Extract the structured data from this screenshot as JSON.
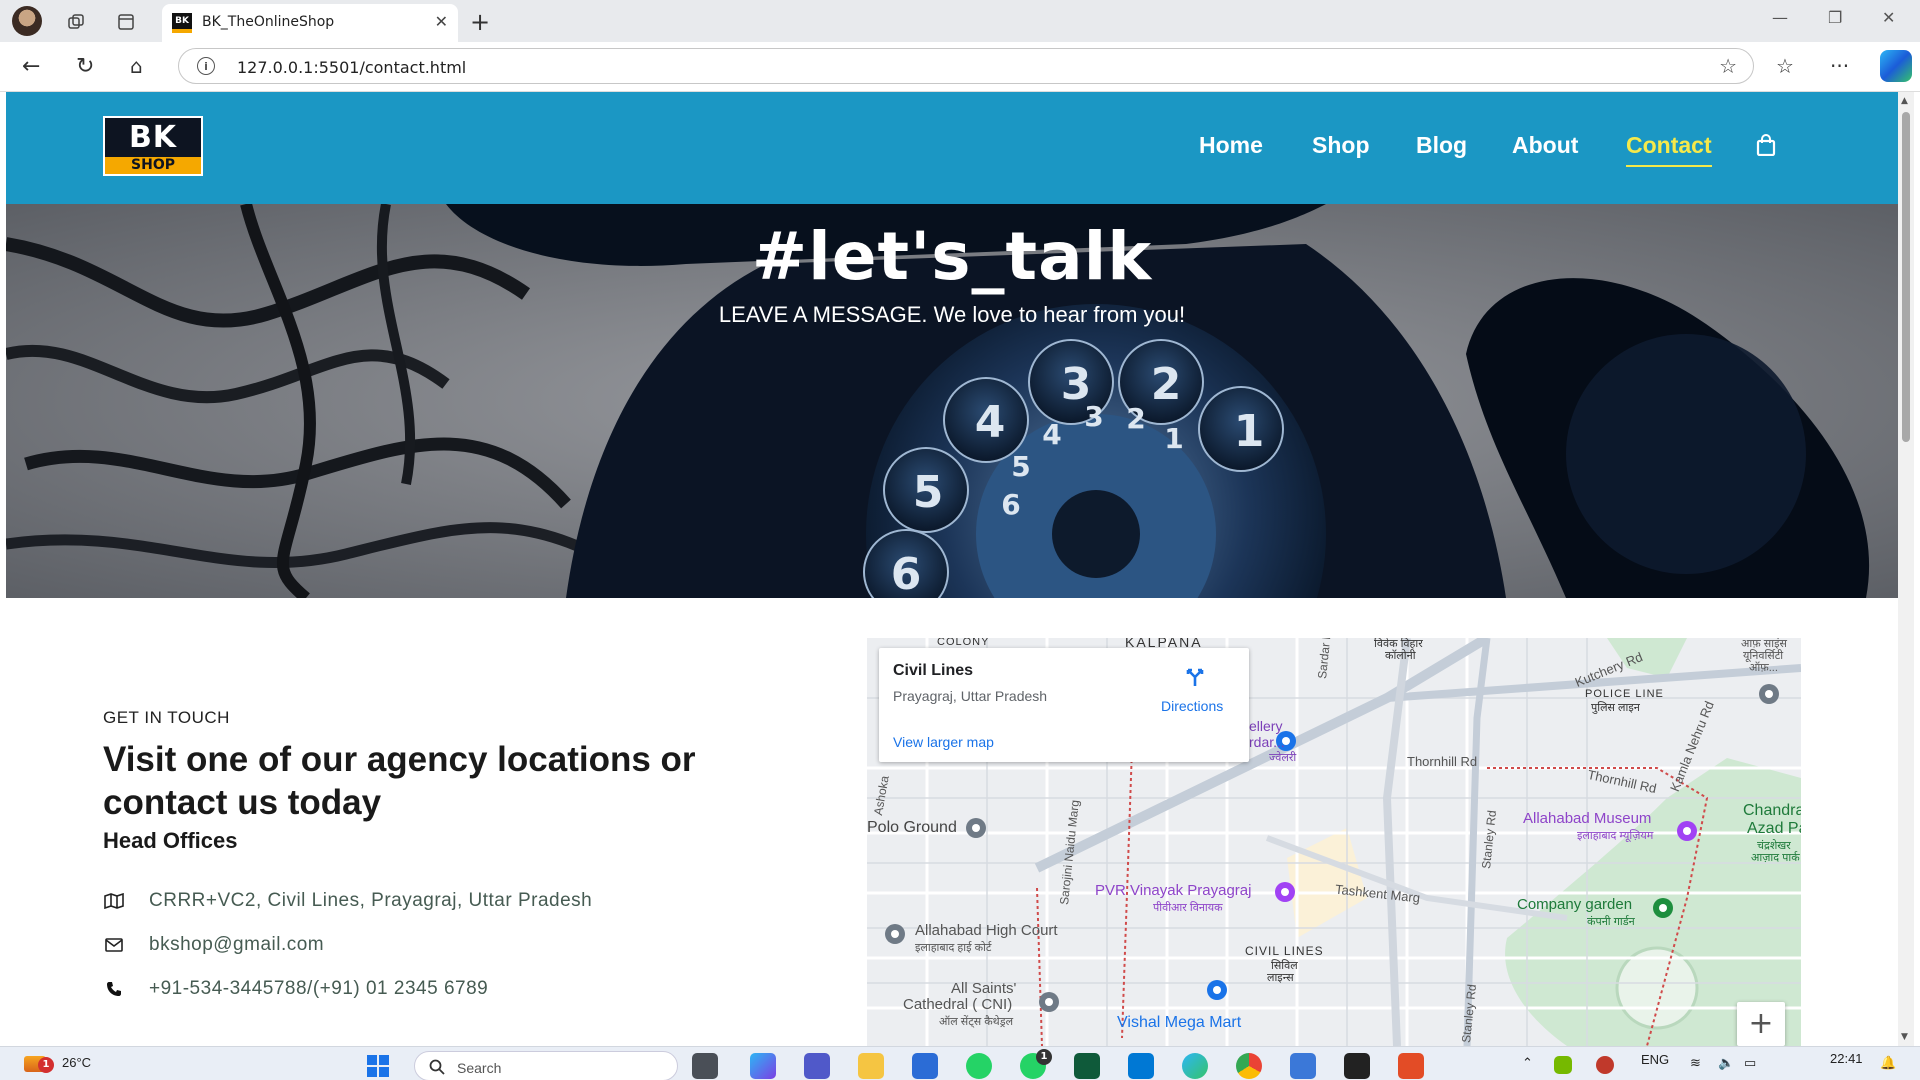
{
  "browser": {
    "tab_title": "BK_TheOnlineShop",
    "tab_favicon_text": "BK",
    "url": "127.0.0.1:5501/contact.html"
  },
  "site": {
    "logo_top": "BK",
    "logo_bottom": "SHOP",
    "nav": [
      "Home",
      "Shop",
      "Blog",
      "About",
      "Contact"
    ],
    "active_nav": "Contact"
  },
  "hero": {
    "title": "#let's_talk",
    "subtitle": "LEAVE A MESSAGE. We love to hear from you!"
  },
  "contact": {
    "eyebrow": "GET IN TOUCH",
    "heading": "Visit one of our agency locations or contact us today",
    "subheading": "Head Offices",
    "address": "CRRR+VC2, Civil Lines, Prayagraj, Uttar Pradesh",
    "email": "bkshop@gmail.com",
    "phone": "+91-534-3445788/(+91) 01 2345 6789"
  },
  "map": {
    "card_title": "Civil Lines",
    "card_subtitle": "Prayagraj, Uttar Pradesh",
    "directions_label": "Directions",
    "larger_map_label": "View larger map",
    "labels": {
      "colony": "COLONY",
      "kalpana": "KALPANA",
      "vivek_vihar": "विवेक विहार",
      "vivek_vihar2": "कॉलोनी",
      "sardar_patel": "Sardar Patel",
      "kutchery": "Kutchery Rd",
      "police_line": "POLICE LINE",
      "police_line_hi": "पुलिस लाइन",
      "kamla_nehru": "Kamla Nehru Rd",
      "thornhill1": "Thornhill Rd",
      "thornhill2": "Thornhill Rd",
      "jewellery": "ellery",
      "jewellery2": "rdar...",
      "jewellery3": "ज्वेलरी",
      "ashoka": "Ashoka",
      "polo": "Polo Ground",
      "sarojini": "Sarojini Naidu Marg",
      "museum": "Allahabad Museum",
      "museum_hi": "इलाहाबाद म्यूज़ियम",
      "chandra1": "Chandrashe",
      "chandra2": "Azad Par",
      "chandra3": "चंद्रशेखर",
      "chandra4": "आज़ाद पार्क",
      "stanley1": "Stanley Rd",
      "stanley2": "Stanley Rd",
      "pvr": "PVR Vinayak Prayagraj",
      "pvr_hi": "पीवीआर विनायक",
      "tashkent": "Tashkent Marg",
      "company": "Company garden",
      "company_hi": "कंपनी गार्डन",
      "court": "Allahabad High Court",
      "court_hi": "इलाहाबाद हाई कोर्ट",
      "civil_lines": "CIVIL LINES",
      "civil_lines_hi1": "सिविल",
      "civil_lines_hi2": "लाइन्स",
      "all_saints1": "All Saints'",
      "all_saints2": "Cathedral ( CNI)",
      "all_saints_hi": "ऑल सेंट्स कैथेड्रल",
      "vishal": "Vishal Mega Mart",
      "uni1": "आफ़ साइंस",
      "uni2": "यूनिवर्सिटी",
      "uni3": "ऑफ़...",
      "zoom_in": "+"
    }
  },
  "taskbar": {
    "weather_temp": "26°C",
    "weather_badge": "1",
    "search_placeholder": "Search",
    "lang": "ENG",
    "time": "22:41",
    "whatsapp_badge": "1"
  },
  "colors": {
    "header_bg": "#1b97c4",
    "active_nav": "#f5e94a",
    "logo_accent": "#f5a800"
  }
}
